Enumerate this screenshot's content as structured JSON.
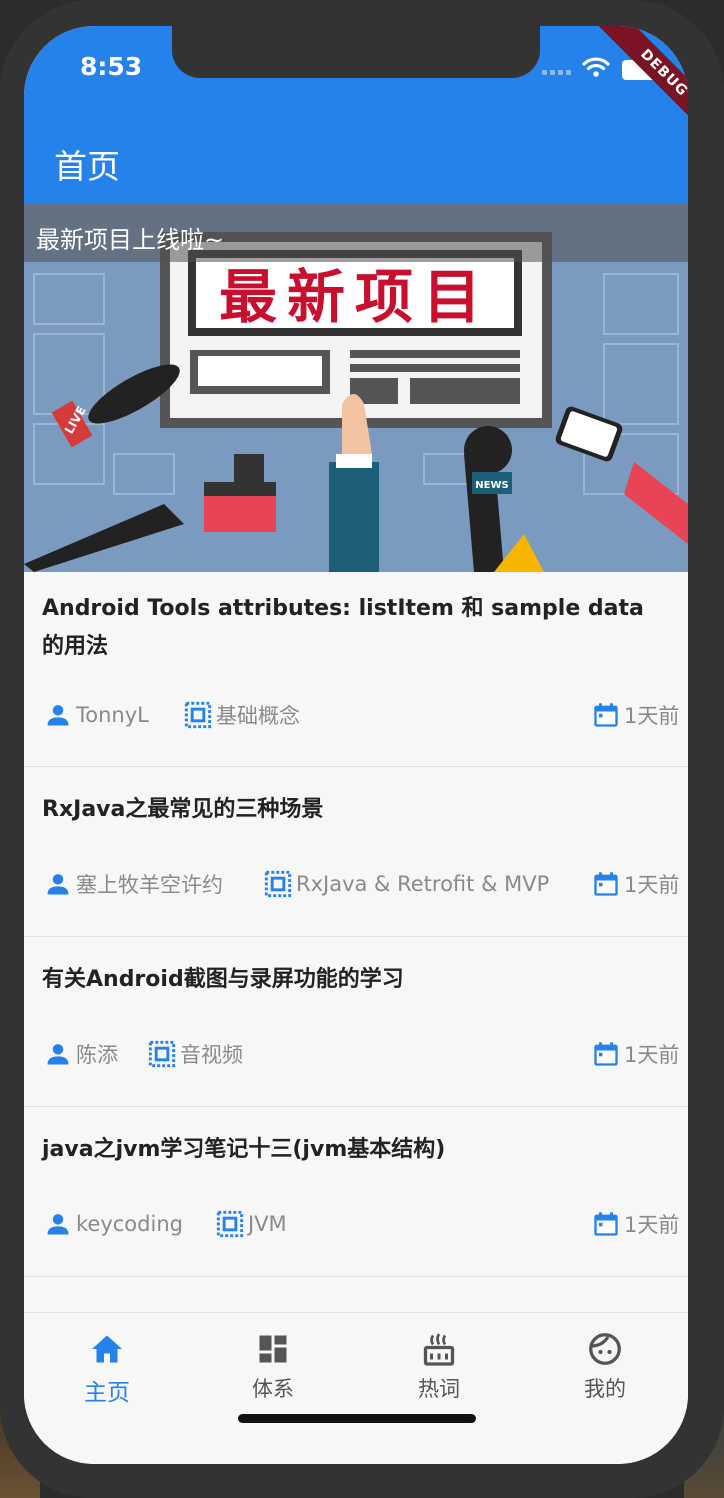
{
  "status": {
    "time": "8:53",
    "debug_label": "DEBUG"
  },
  "appbar": {
    "title": "首页"
  },
  "banner": {
    "caption": "最新项目上线啦~",
    "headline": "最新项目",
    "mic_label_left": "LIVE",
    "mic_label_news": "NEWS"
  },
  "articles": [
    {
      "title": "Android Tools attributes: listItem 和 sample data 的用法",
      "author": "TonnyL",
      "category": "基础概念",
      "time": "1天前"
    },
    {
      "title": "RxJava之最常见的三种场景",
      "author": "塞上牧羊空许约",
      "category": "RxJava & Retrofit & MVP",
      "time": "1天前"
    },
    {
      "title": "有关Android截图与录屏功能的学习",
      "author": "陈添",
      "category": "音视频",
      "time": "1天前"
    },
    {
      "title": "java之jvm学习笔记十三(jvm基本结构)",
      "author": "keycoding",
      "category": "JVM",
      "time": "1天前"
    }
  ],
  "tabs": [
    {
      "label": "主页",
      "icon": "home-icon"
    },
    {
      "label": "体系",
      "icon": "dashboard-icon"
    },
    {
      "label": "热词",
      "icon": "hot-icon"
    },
    {
      "label": "我的",
      "icon": "face-icon"
    }
  ],
  "colors": {
    "primary": "#2582eb",
    "debug": "#7a1323",
    "meta_text": "#8a8a8a"
  }
}
